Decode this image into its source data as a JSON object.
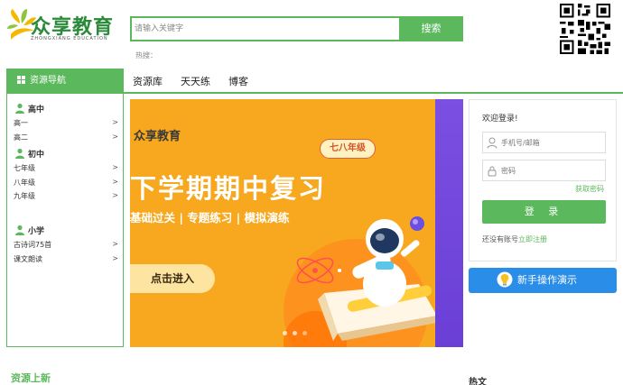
{
  "header": {
    "logo_text": "众享教育",
    "logo_sub": "ZHONGXIANG EDUCATION",
    "search_placeholder": "请输入关键字",
    "search_button": "搜索",
    "hot_label": "热搜："
  },
  "nav": {
    "resource_nav": "资源导航",
    "links": [
      "资源库",
      "天天练",
      "博客"
    ]
  },
  "sidebar": {
    "categories": [
      {
        "title": "高中",
        "items": [
          "高一",
          "高二"
        ]
      },
      {
        "title": "初中",
        "items": [
          "七年级",
          "八年级",
          "九年级"
        ]
      },
      {
        "title": "小学",
        "items": [
          "古诗词75首",
          "课文朗读"
        ]
      }
    ],
    "arrow": ">"
  },
  "banner": {
    "logo": "众享教育",
    "tag": "七八年级",
    "title": "下学期期中复习",
    "subtitle": "基础过关 | 专题练习 | 模拟演练",
    "button": "点击进入"
  },
  "login": {
    "welcome": "欢迎登录!",
    "phone_placeholder": "手机号/邮箱",
    "password_placeholder": "密码",
    "forgot": "获取密码",
    "submit": "登 录",
    "no_account": "还没有账号",
    "register": "立即注册"
  },
  "guide_button": "新手操作演示",
  "section": {
    "title": "资源上新",
    "right_title": "热文"
  },
  "colors": {
    "brand_green": "#5cb85c",
    "banner_orange": "#f7a81e",
    "guide_blue": "#2a8ee8"
  }
}
